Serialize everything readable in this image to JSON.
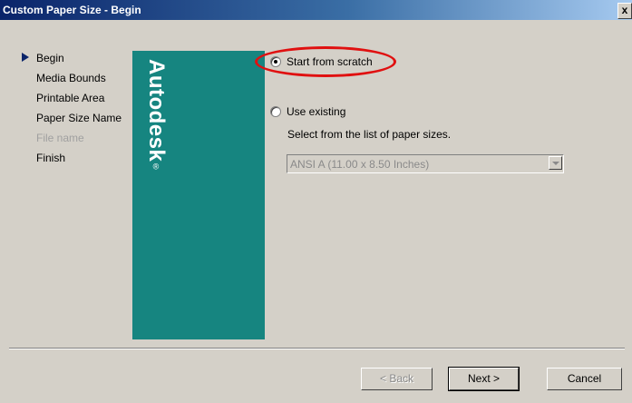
{
  "window": {
    "title": "Custom Paper Size - Begin",
    "close_label": "x"
  },
  "steps": [
    {
      "label": "Begin",
      "current": true,
      "enabled": true
    },
    {
      "label": "Media Bounds",
      "current": false,
      "enabled": true
    },
    {
      "label": "Printable Area",
      "current": false,
      "enabled": true
    },
    {
      "label": "Paper Size Name",
      "current": false,
      "enabled": true
    },
    {
      "label": "File name",
      "current": false,
      "enabled": false
    },
    {
      "label": "Finish",
      "current": false,
      "enabled": true
    }
  ],
  "banner": {
    "brand": "Autodesk",
    "reg": "®",
    "color": "#168580"
  },
  "options": {
    "scratch_label": "Start from scratch",
    "scratch_selected": true,
    "existing_label": "Use existing",
    "existing_selected": false,
    "existing_hint": "Select from the list of paper sizes.",
    "paper_size_value": "ANSI A (11.00 x 8.50 Inches)"
  },
  "buttons": {
    "back": "< Back",
    "next": "Next >",
    "cancel": "Cancel"
  },
  "colors": {
    "highlight": "#e01010",
    "title_bar": "#0a246a",
    "face": "#d4d0c8"
  }
}
